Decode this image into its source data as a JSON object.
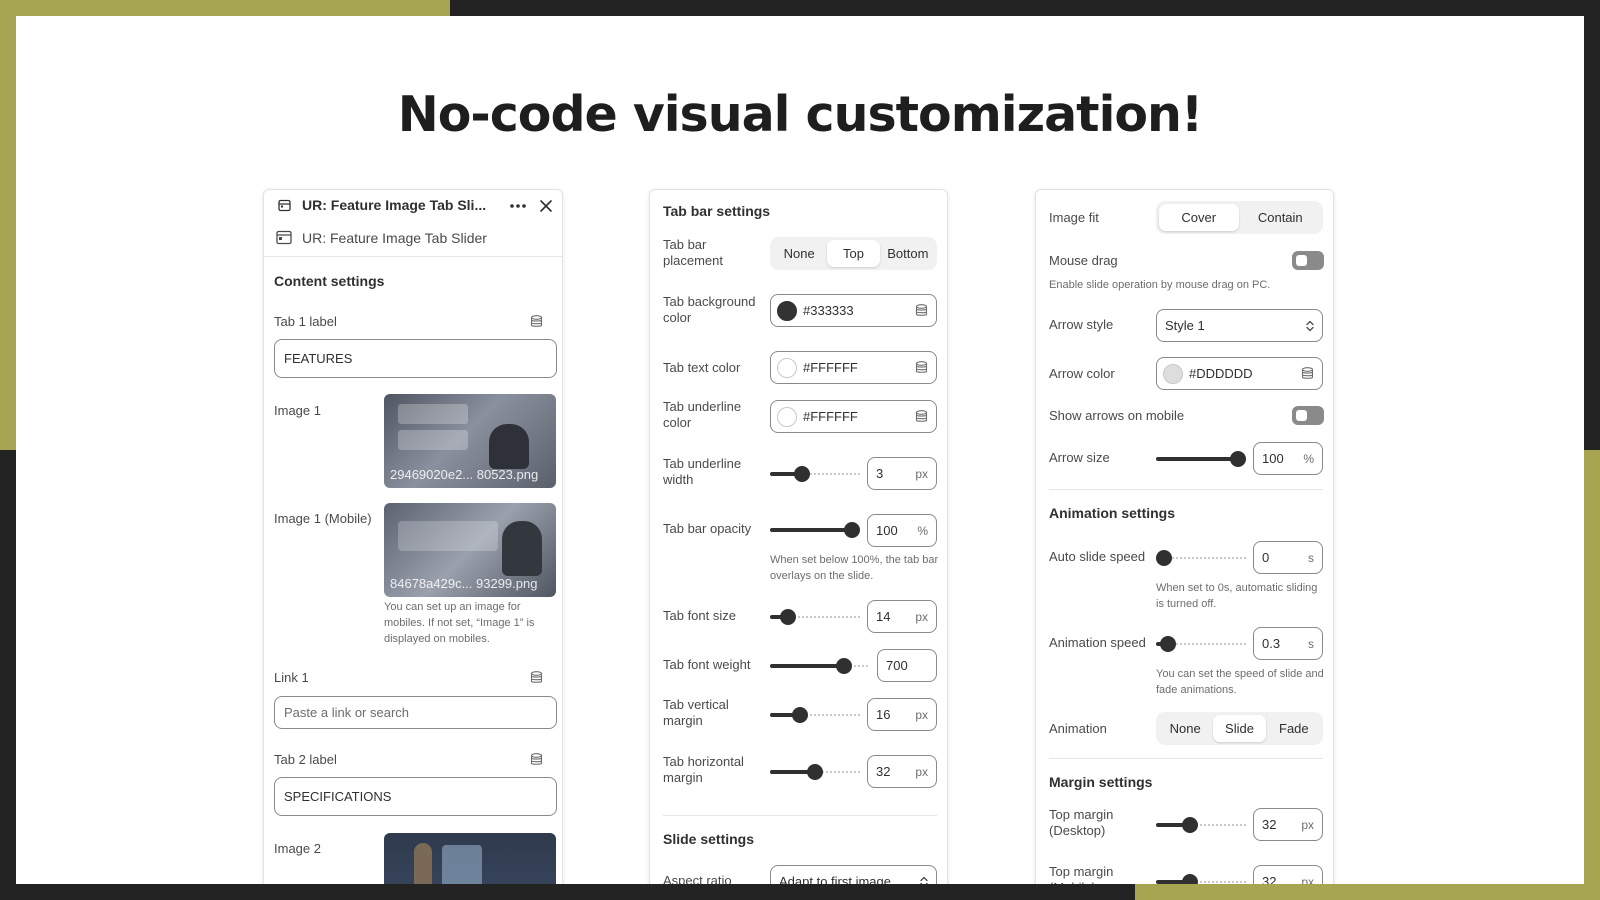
{
  "headline": "No-code visual customization!",
  "panel1": {
    "header_title": "UR: Feature Image Tab Sli...",
    "block_name": "UR: Feature Image Tab Slider",
    "section_title": "Content settings",
    "tab1_label": "Tab 1 label",
    "tab1_value": "FEATURES",
    "image1_label": "Image 1",
    "image1_file": "29469020e2... 80523.png",
    "image1_mobile_label": "Image 1 (Mobile)",
    "image1_mobile_file": "84678a429c... 93299.png",
    "image1_mobile_hint": "You can set up an image for mobiles. If not set, “Image 1” is displayed on mobiles.",
    "link1_label": "Link 1",
    "link1_placeholder": "Paste a link or search",
    "tab2_label": "Tab 2 label",
    "tab2_value": "SPECIFICATIONS",
    "image2_label": "Image 2"
  },
  "panel2": {
    "section_title": "Tab bar settings",
    "placement_label": "Tab bar placement",
    "placement_options": [
      "None",
      "Top",
      "Bottom"
    ],
    "placement_selected": "Top",
    "bg_color_label": "Tab background color",
    "bg_color_value": "#333333",
    "text_color_label": "Tab text color",
    "text_color_value": "#FFFFFF",
    "underline_color_label": "Tab underline color",
    "underline_color_value": "#FFFFFF",
    "underline_width_label": "Tab underline width",
    "underline_width_value": "3",
    "opacity_label": "Tab bar opacity",
    "opacity_value": "100",
    "opacity_hint": "When set below 100%, the tab bar overlays on the slide.",
    "font_size_label": "Tab font size",
    "font_size_value": "14",
    "font_weight_label": "Tab font weight",
    "font_weight_value": "700",
    "vmargin_label": "Tab vertical margin",
    "vmargin_value": "16",
    "hmargin_label": "Tab horizontal margin",
    "hmargin_value": "32",
    "slide_section_title": "Slide settings",
    "aspect_label": "Aspect ratio",
    "aspect_value": "Adapt to first image",
    "unit_px": "px",
    "unit_pct": "%"
  },
  "panel3": {
    "image_fit_label": "Image fit",
    "image_fit_options": [
      "Cover",
      "Contain"
    ],
    "image_fit_selected": "Cover",
    "mouse_drag_label": "Mouse drag",
    "mouse_drag_hint": "Enable slide operation by mouse drag on PC.",
    "arrow_style_label": "Arrow style",
    "arrow_style_value": "Style 1",
    "arrow_color_label": "Arrow color",
    "arrow_color_value": "#DDDDDD",
    "arrows_mobile_label": "Show arrows on mobile",
    "arrow_size_label": "Arrow size",
    "arrow_size_value": "100",
    "animation_section_title": "Animation settings",
    "auto_speed_label": "Auto slide speed",
    "auto_speed_value": "0",
    "auto_speed_hint": "When set to 0s, automatic sliding is turned off.",
    "anim_speed_label": "Animation speed",
    "anim_speed_value": "0.3",
    "anim_speed_hint": "You can set the speed of slide and fade animations.",
    "animation_label": "Animation",
    "animation_options": [
      "None",
      "Slide",
      "Fade"
    ],
    "animation_selected": "Slide",
    "margin_section_title": "Margin settings",
    "top_margin_desktop_label": "Top margin (Desktop)",
    "top_margin_desktop_value": "32",
    "top_margin_mobile_label": "Top margin (Mobile)",
    "top_margin_mobile_value": "32",
    "unit_s": "s",
    "unit_px": "px",
    "unit_pct": "%"
  },
  "sliders": {
    "underline_width": 0.33,
    "opacity": 1.0,
    "font_size": 0.14,
    "font_weight": 0.78,
    "vmargin": 0.3,
    "hmargin": 0.5,
    "arrow_size": 1.0,
    "auto_speed": 0.0,
    "anim_speed": 0.06,
    "top_margin_desktop": 0.35,
    "top_margin_mobile": 0.35
  },
  "colors": {
    "accent": "#a8a552",
    "frame": "#232323"
  }
}
